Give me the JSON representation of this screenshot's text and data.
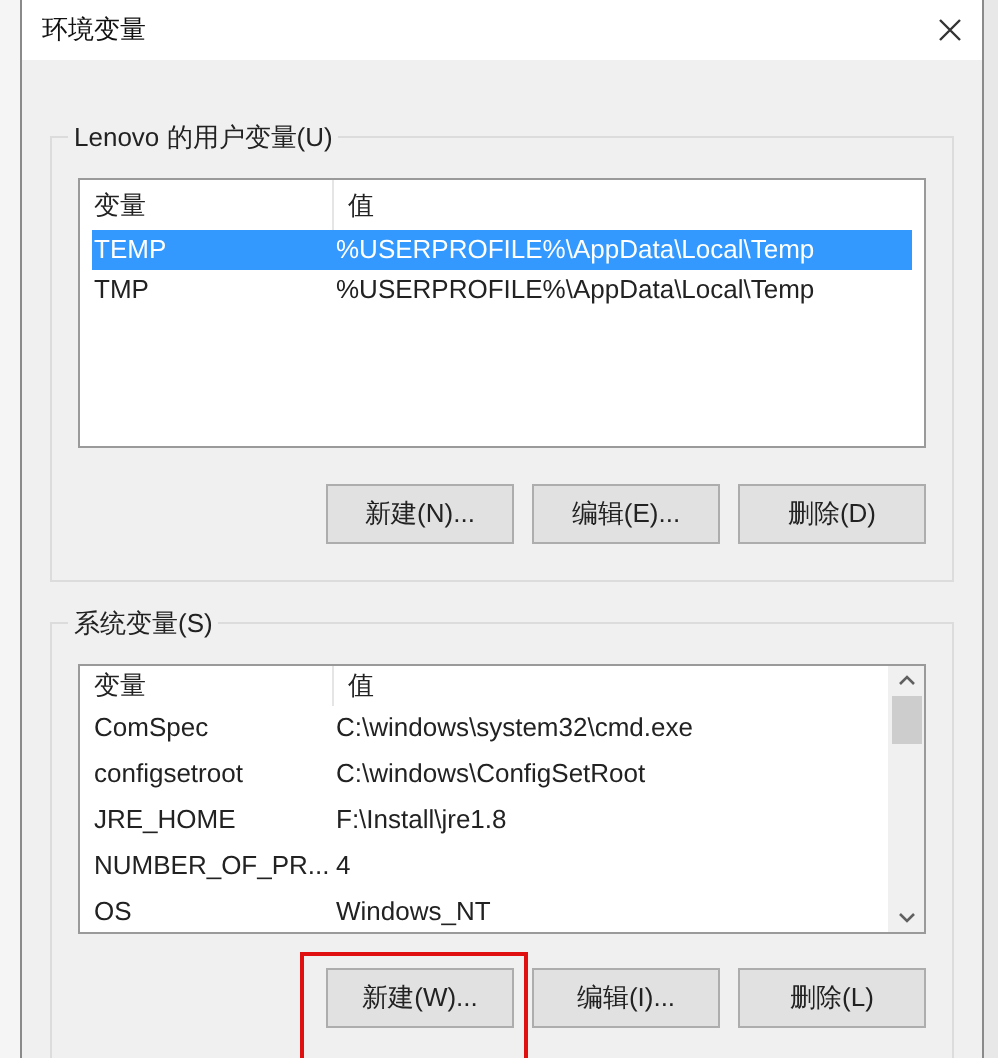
{
  "window": {
    "title": "环境变量"
  },
  "user_variables": {
    "title": "Lenovo 的用户变量(U)",
    "columns": [
      "变量",
      "值"
    ],
    "rows": [
      {
        "name": "TEMP",
        "value": "%USERPROFILE%\\AppData\\Local\\Temp",
        "selected": true
      },
      {
        "name": "TMP",
        "value": "%USERPROFILE%\\AppData\\Local\\Temp",
        "selected": false
      }
    ],
    "buttons": [
      {
        "label": "新建(N)...",
        "highlighted": false
      },
      {
        "label": "编辑(E)...",
        "highlighted": false
      },
      {
        "label": "删除(D)",
        "highlighted": false
      }
    ]
  },
  "system_variables": {
    "title": "系统变量(S)",
    "columns": [
      "变量",
      "值"
    ],
    "rows": [
      {
        "name": "ComSpec",
        "value": "C:\\windows\\system32\\cmd.exe",
        "selected": false
      },
      {
        "name": "configsetroot",
        "value": "C:\\windows\\ConfigSetRoot",
        "selected": false
      },
      {
        "name": "JRE_HOME",
        "value": "F:\\Install\\jre1.8",
        "selected": false
      },
      {
        "name": "NUMBER_OF_PR...",
        "value": "4",
        "selected": false
      },
      {
        "name": "OS",
        "value": "Windows_NT",
        "selected": false
      }
    ],
    "buttons": [
      {
        "label": "新建(W)...",
        "highlighted": true
      },
      {
        "label": "编辑(I)...",
        "highlighted": false
      },
      {
        "label": "删除(L)",
        "highlighted": false
      }
    ]
  }
}
